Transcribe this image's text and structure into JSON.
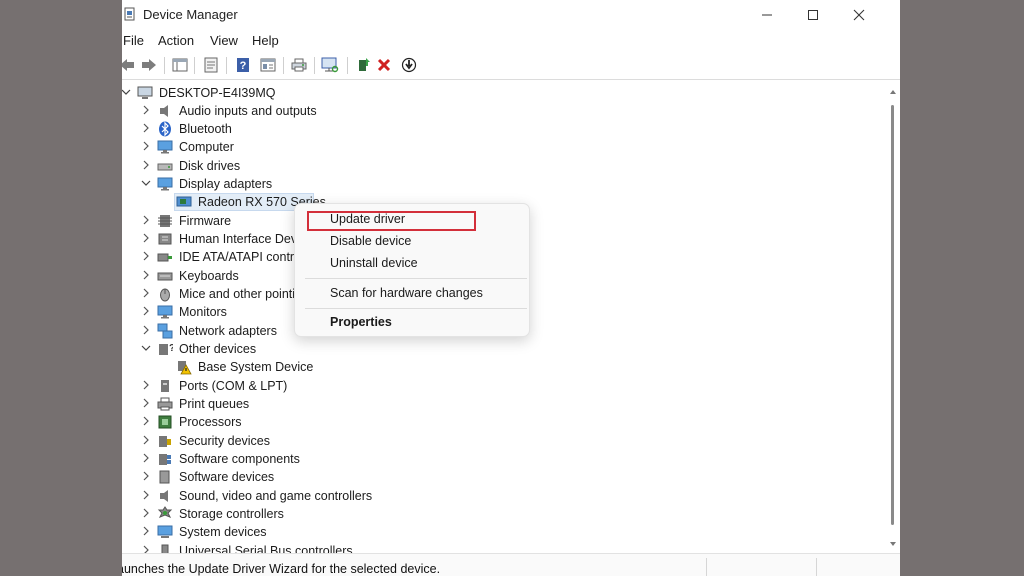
{
  "window": {
    "title": "Device Manager"
  },
  "menu": [
    "File",
    "Action",
    "View",
    "Help"
  ],
  "tree": {
    "root": "DESKTOP-E4I39MQ",
    "items": [
      {
        "label": "Audio inputs and outputs"
      },
      {
        "label": "Bluetooth"
      },
      {
        "label": "Computer"
      },
      {
        "label": "Disk drives"
      },
      {
        "label": "Display adapters"
      },
      {
        "label": "Radeon RX 570 Series"
      },
      {
        "label": "Firmware"
      },
      {
        "label": "Human Interface Dev"
      },
      {
        "label": "IDE ATA/ATAPI contro"
      },
      {
        "label": "Keyboards"
      },
      {
        "label": "Mice and other pointi"
      },
      {
        "label": "Monitors"
      },
      {
        "label": "Network adapters"
      },
      {
        "label": "Other devices"
      },
      {
        "label": "Base System Device"
      },
      {
        "label": "Ports (COM & LPT)"
      },
      {
        "label": "Print queues"
      },
      {
        "label": "Processors"
      },
      {
        "label": "Security devices"
      },
      {
        "label": "Software components"
      },
      {
        "label": "Software devices"
      },
      {
        "label": "Sound, video and game controllers"
      },
      {
        "label": "Storage controllers"
      },
      {
        "label": "System devices"
      },
      {
        "label": "Universal Serial Bus controllers"
      }
    ]
  },
  "context_menu": {
    "items": [
      "Update driver",
      "Disable device",
      "Uninstall device",
      "Scan for hardware changes",
      "Properties"
    ]
  },
  "status": {
    "text": "aunches the Update Driver Wizard for the selected device."
  },
  "colors": {
    "highlight": "#d32f3a",
    "background": "#767070"
  }
}
